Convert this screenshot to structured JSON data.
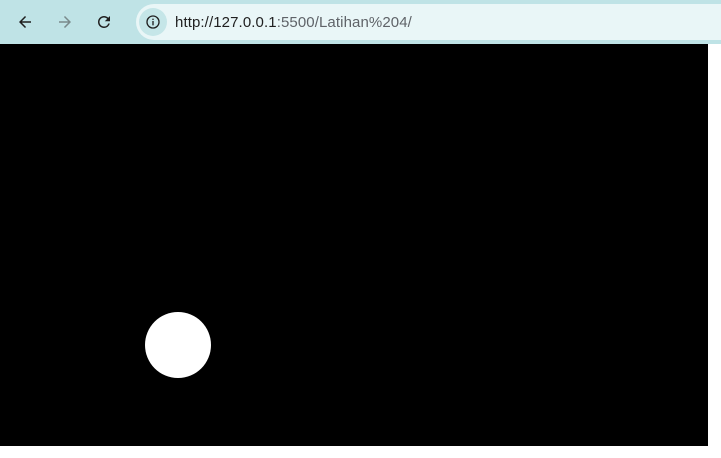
{
  "browser": {
    "url_host": "http://127.0.0.1",
    "url_rest": ":5500/Latihan%204/",
    "icons": {
      "back": "arrow-left",
      "forward": "arrow-right",
      "reload": "refresh",
      "site_info": "info-circle"
    }
  },
  "page": {
    "canvas_color": "#000000",
    "ball_color": "#ffffff"
  }
}
